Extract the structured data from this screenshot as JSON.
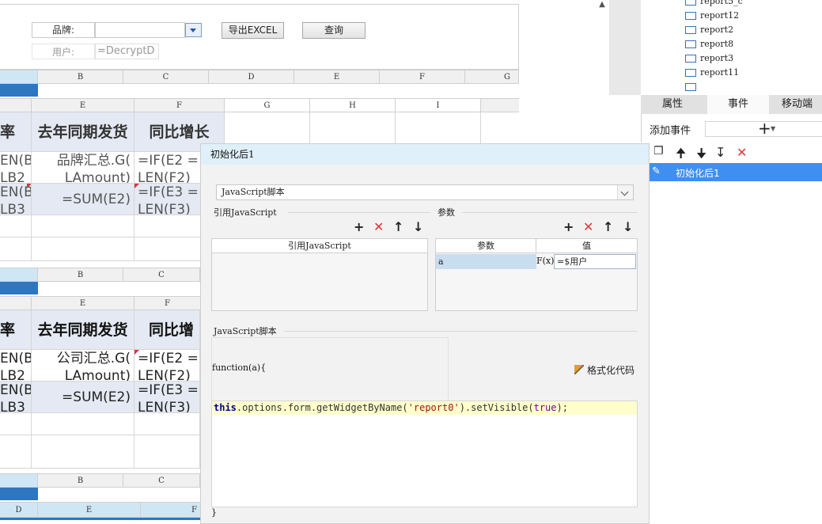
{
  "form": {
    "brand_label": "品牌:",
    "user_label": "用户:",
    "user_value": "=DecryptD",
    "export_button": "导出EXCEL",
    "query_button": "查询"
  },
  "sheet": {
    "top_columns": [
      "B",
      "C",
      "D",
      "E",
      "F",
      "G"
    ],
    "grid1_columns": [
      "E",
      "F",
      "G",
      "H",
      "I"
    ],
    "grid1_headers": [
      "率",
      "去年同期发货",
      "同比增长"
    ],
    "grid1_row1": [
      "EN(B",
      "品牌汇总.G(",
      "=IF(E2 ="
    ],
    "grid1_row1b": [
      "LB2",
      "LAmount)",
      "LEN(F2)"
    ],
    "grid1_row2": [
      "EN(B",
      "=SUM(E2)",
      "=IF(E3 ="
    ],
    "grid1_row2b": [
      "LB3",
      "",
      "LEN(F3)"
    ],
    "grid2_columns_top": [
      "B",
      "C"
    ],
    "grid2_columns": [
      "E",
      "F"
    ],
    "grid2_headers": [
      "率",
      "去年同期发货",
      "同比增"
    ],
    "grid2_row1": [
      "EN(B",
      "公司汇总.G(",
      "=IF(E2 ="
    ],
    "grid2_row1b": [
      "LB2",
      "LAmount)",
      "LEN(F2)"
    ],
    "grid2_row2": [
      "EN(B",
      "=SUM(E2)",
      "=IF(E3 ="
    ],
    "grid2_row2b": [
      "LB3",
      "",
      "LEN(F3)"
    ],
    "grid3_columns_top": [
      "B",
      "C"
    ],
    "grid3_columns": [
      "D",
      "E",
      "F"
    ]
  },
  "tree": {
    "items": [
      "report5_c",
      "report12",
      "report2",
      "report8",
      "report3",
      "report11"
    ]
  },
  "tabs": {
    "items": [
      "属性",
      "事件",
      "移动端"
    ],
    "active": "事件"
  },
  "events": {
    "add_label": "添加事件",
    "add_icon": "plus-icon",
    "item_label": "初始化后1"
  },
  "dialog": {
    "title": "初始化后1",
    "language": "JavaScript脚本",
    "ref_js_label": "引用JavaScript",
    "ref_js_column": "引用JavaScript",
    "params_label": "参数",
    "params_columns": [
      "参数",
      "值"
    ],
    "param_name": "a",
    "param_fx": "F(x)",
    "param_value": "=$用户",
    "script_label": "JavaScript脚本",
    "function_header": "function(a){",
    "format_code": "格式化代码",
    "code_kw": "this",
    "code_mid": ".options.form.getWidgetByName(",
    "code_str": "'report0'",
    "code_mid2": ").setVisible(",
    "code_bool": "true",
    "code_end": ");",
    "function_close": "}"
  },
  "colors": {
    "selection_blue": "#3f8ff0",
    "header_blue": "#cfe6f5",
    "dialog_title_bg": "#dff0fa",
    "delete_red": "#e03535"
  }
}
